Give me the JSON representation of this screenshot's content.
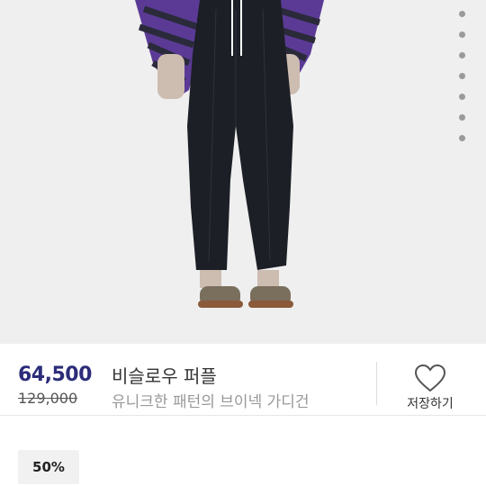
{
  "product": {
    "sale_price": "64,500",
    "original_price": "129,000",
    "title": "비슬로우 퍼플",
    "subtitle": "유니크한 패턴의 브이넥 가디건"
  },
  "wishlist": {
    "label": "저장하기",
    "icon": "heart-icon"
  },
  "discount": {
    "label": "50%"
  },
  "gallery": {
    "dot_count": 7
  },
  "colors": {
    "price": "#2c2c7a",
    "cardigan": "#5b3a96",
    "pants": "#1c1f26",
    "background": "#efefef"
  }
}
